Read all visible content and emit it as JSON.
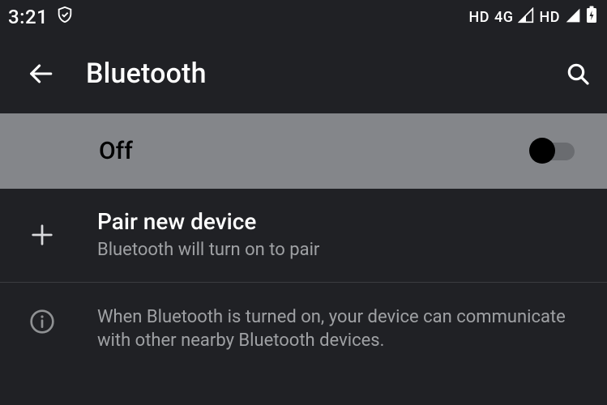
{
  "status_bar": {
    "time": "3:21",
    "shield_icon": "shield",
    "hd_label_1": "HD",
    "net_label": "4G",
    "hd_label_2": "HD"
  },
  "app_bar": {
    "title": "Bluetooth"
  },
  "toggle": {
    "state_label": "Off",
    "is_on": false
  },
  "pair_row": {
    "title": "Pair new device",
    "subtitle": "Bluetooth will turn on to pair"
  },
  "info_row": {
    "text": "When Bluetooth is turned on, your device can communicate with other nearby Bluetooth devices."
  }
}
